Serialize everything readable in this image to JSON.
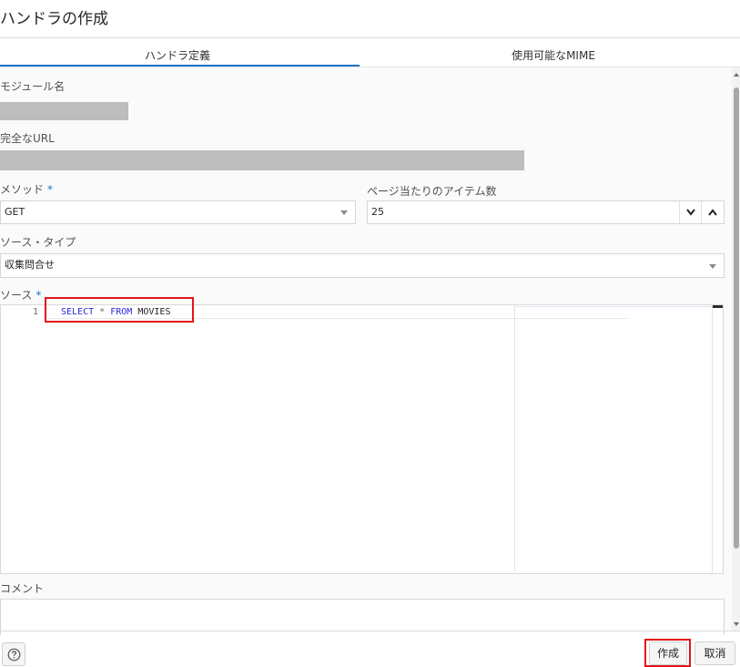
{
  "dialog": {
    "title": "ハンドラの作成"
  },
  "tabs": [
    {
      "label": "ハンドラ定義",
      "active": true
    },
    {
      "label": "使用可能なMIME",
      "active": false
    }
  ],
  "form": {
    "module_name_label": "モジュール名",
    "full_url_label": "完全なURL",
    "method_label": "メソッド",
    "method_required": "*",
    "method_value": "GET",
    "items_per_page_label": "ページ当たりのアイテム数",
    "items_per_page_value": "25",
    "source_type_label": "ソース・タイプ",
    "source_type_value": "収集問合せ",
    "source_label": "ソース",
    "source_required": "*",
    "comment_label": "コメント"
  },
  "editor": {
    "line_number": "1",
    "tokens": {
      "kw1": "SELECT",
      "op": "*",
      "kw2": "FROM",
      "ident": "MOVIES"
    }
  },
  "footer": {
    "create_label": "作成",
    "cancel_label": "取消",
    "help_icon": "question-circle-icon"
  },
  "colors": {
    "accent": "#1a73c9",
    "highlight": "#e3141b",
    "keyword": "#2b2bdc"
  }
}
